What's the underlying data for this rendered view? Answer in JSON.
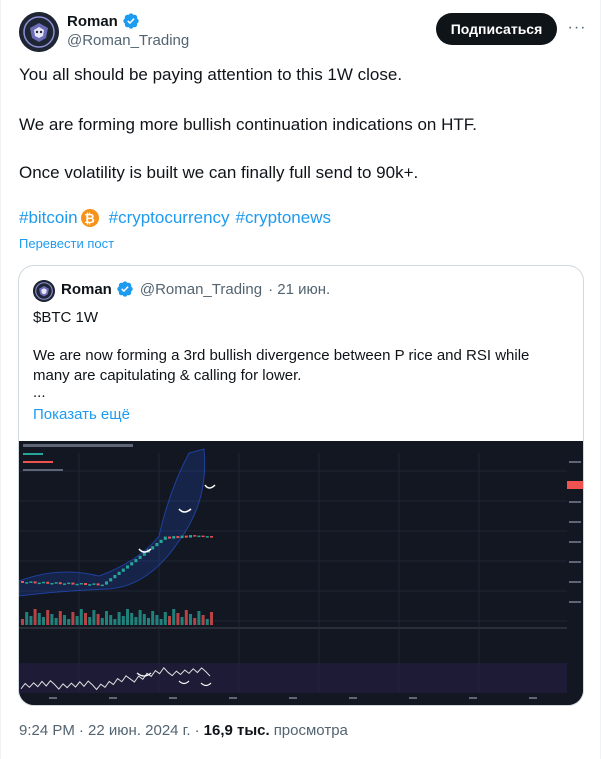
{
  "author": {
    "name": "Roman",
    "handle": "@Roman_Trading"
  },
  "actions": {
    "subscribe_label": "Подписаться",
    "more_label": "···"
  },
  "tweet": {
    "lines": [
      "You all should be paying attention to this 1W close.",
      "We are forming more bullish continuation indications on HTF.",
      "Once volatility is built we can finally full send to 90k+."
    ],
    "hashtags": [
      "#bitcoin",
      "#cryptocurrency",
      "#cryptonews"
    ],
    "translate_label": "Перевести пост"
  },
  "quote": {
    "name": "Roman",
    "handle": "@Roman_Trading",
    "date": "· 21 июн.",
    "title": "$BTC 1W",
    "text_lines": [
      "We are now forming a 3rd bullish divergence between P rice and RSI while",
      "many are capitulating & calling for lower.",
      "..."
    ],
    "show_more_label": "Показать ещё"
  },
  "footer": {
    "time": "9:24 PM",
    "date": "· 22 июн. 2024 г. ·",
    "views": "16,9 тыс.",
    "views_label": "просмотра"
  },
  "colors": {
    "accent": "#1d9bf0",
    "verified": "#1d9bf0",
    "chart_bg": "#131722",
    "bull": "#26a69a",
    "bear": "#ef5350"
  }
}
